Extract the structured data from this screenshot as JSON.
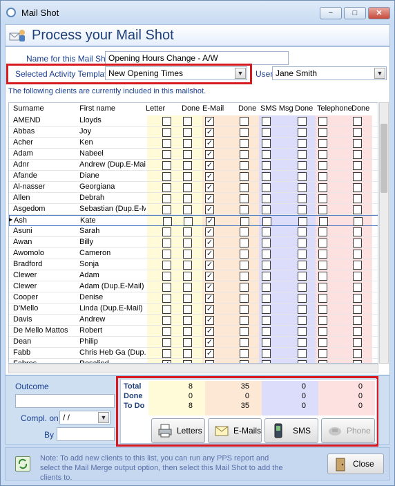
{
  "window": {
    "title": "Mail Shot"
  },
  "header": {
    "title": "Process your Mail Shot"
  },
  "form": {
    "name_label": "Name for this Mail Shot",
    "name_value": "Opening Hours Change - A/W",
    "template_label": "Selected Activity Template",
    "template_value": "New Opening Times",
    "user_label": "User",
    "user_value": "Jane Smith",
    "info": "The following clients are currently included in this mailshot."
  },
  "grid": {
    "columns": [
      "Surname",
      "First name",
      "Letter",
      "Done",
      "E-Mail",
      "Done",
      "SMS Msg",
      "Done",
      "Telephone",
      "Done"
    ],
    "rows": [
      {
        "surname": "AMEND",
        "first": "Lloyds",
        "email": true,
        "letter": false
      },
      {
        "surname": "Abbas",
        "first": "Joy",
        "email": true,
        "letter": false
      },
      {
        "surname": "Acher",
        "first": "Ken",
        "email": true,
        "letter": false
      },
      {
        "surname": "Adam",
        "first": "Nabeel",
        "email": true,
        "letter": false
      },
      {
        "surname": "Adnr",
        "first": "Andrew (Dup.E-Mail",
        "email": true,
        "letter": false
      },
      {
        "surname": "Afande",
        "first": "Diane",
        "email": true,
        "letter": false
      },
      {
        "surname": "Al-nasser",
        "first": "Georgiana",
        "email": true,
        "letter": false
      },
      {
        "surname": "Allen",
        "first": "Debrah",
        "email": true,
        "letter": false
      },
      {
        "surname": "Asgedom",
        "first": "Sebastian (Dup.E-M",
        "email": true,
        "letter": false
      },
      {
        "surname": "Ash",
        "first": "Kate",
        "email": true,
        "letter": false
      },
      {
        "surname": "Asuni",
        "first": "Sarah",
        "email": true,
        "letter": false
      },
      {
        "surname": "Awan",
        "first": "Billy",
        "email": true,
        "letter": false
      },
      {
        "surname": "Awomolo",
        "first": "Cameron",
        "email": true,
        "letter": false
      },
      {
        "surname": "Bradford",
        "first": "Sonja",
        "email": true,
        "letter": false
      },
      {
        "surname": "Clewer",
        "first": "Adam",
        "email": true,
        "letter": false
      },
      {
        "surname": "Clewer",
        "first": "Adam (Dup.E-Mail)",
        "email": true,
        "letter": false
      },
      {
        "surname": "Cooper",
        "first": "Denise",
        "email": true,
        "letter": false
      },
      {
        "surname": "D'Mello",
        "first": "Linda (Dup.E-Mail)",
        "email": true,
        "letter": false
      },
      {
        "surname": "Davis",
        "first": "Andrew",
        "email": true,
        "letter": false
      },
      {
        "surname": "De Mello Mattos",
        "first": "Robert",
        "email": true,
        "letter": false
      },
      {
        "surname": "Dean",
        "first": "Philip",
        "email": true,
        "letter": false
      },
      {
        "surname": "Fabb",
        "first": "Chris Heb Ga (Dup.E",
        "email": true,
        "letter": false
      },
      {
        "surname": "Fabros",
        "first": "Rosalind",
        "email": false,
        "letter": true
      }
    ],
    "selected_index": 9
  },
  "outcome": {
    "label": "Outcome",
    "compl_label": "Compl. on",
    "compl_value": " / /",
    "by_label": "By"
  },
  "totals": {
    "labels": [
      "Total",
      "Done",
      "To Do"
    ],
    "letters": [
      "8",
      "0",
      "8"
    ],
    "emails": [
      "35",
      "0",
      "35"
    ],
    "sms": [
      "0",
      "0",
      "0"
    ],
    "phone": [
      "0",
      "0",
      "0"
    ]
  },
  "buttons": {
    "letters": "Letters",
    "emails": "E-Mails",
    "sms": "SMS",
    "phone": "Phone",
    "close": "Close"
  },
  "footer": {
    "note": "Note: To add new clients to this list, you can run any PPS report and select the Mail Merge output option, then select this Mail Shot to add the clients to."
  },
  "colors": {
    "letter_col": "#fffbd8",
    "email_col": "#fde8d6",
    "sms_col": "#dcdcfb",
    "phone_col": "#fde0e0",
    "highlight": "#d71920"
  }
}
